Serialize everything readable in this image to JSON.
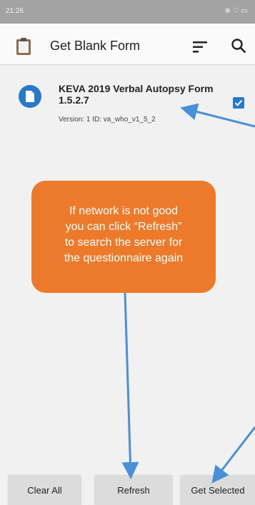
{
  "status_bar": {
    "time": "21:26",
    "signal_text": ".ıll ̈ıl",
    "right_icons": "⊕ ♡ ▭"
  },
  "app_bar": {
    "title": "Get Blank Form",
    "icons": [
      "clipboard-icon",
      "sort-icon",
      "search-icon"
    ]
  },
  "form_item": {
    "title": "KEVA 2019 Verbal Autopsy Form 1.5.2.7",
    "subtitle": "Version: 1 ID: va_who_v1_5_2",
    "checked": true
  },
  "callout": {
    "lines": [
      "If network is not good",
      "you can click “Refresh”",
      "to search the server for",
      "the questionnaire again"
    ]
  },
  "buttons": {
    "clear_all": "Clear All",
    "refresh": "Refresh",
    "get_selected": "Get Selected"
  },
  "colors": {
    "accent": "#2979c9",
    "callout": "#ec7a2a",
    "arrow": "#4a90d9"
  }
}
